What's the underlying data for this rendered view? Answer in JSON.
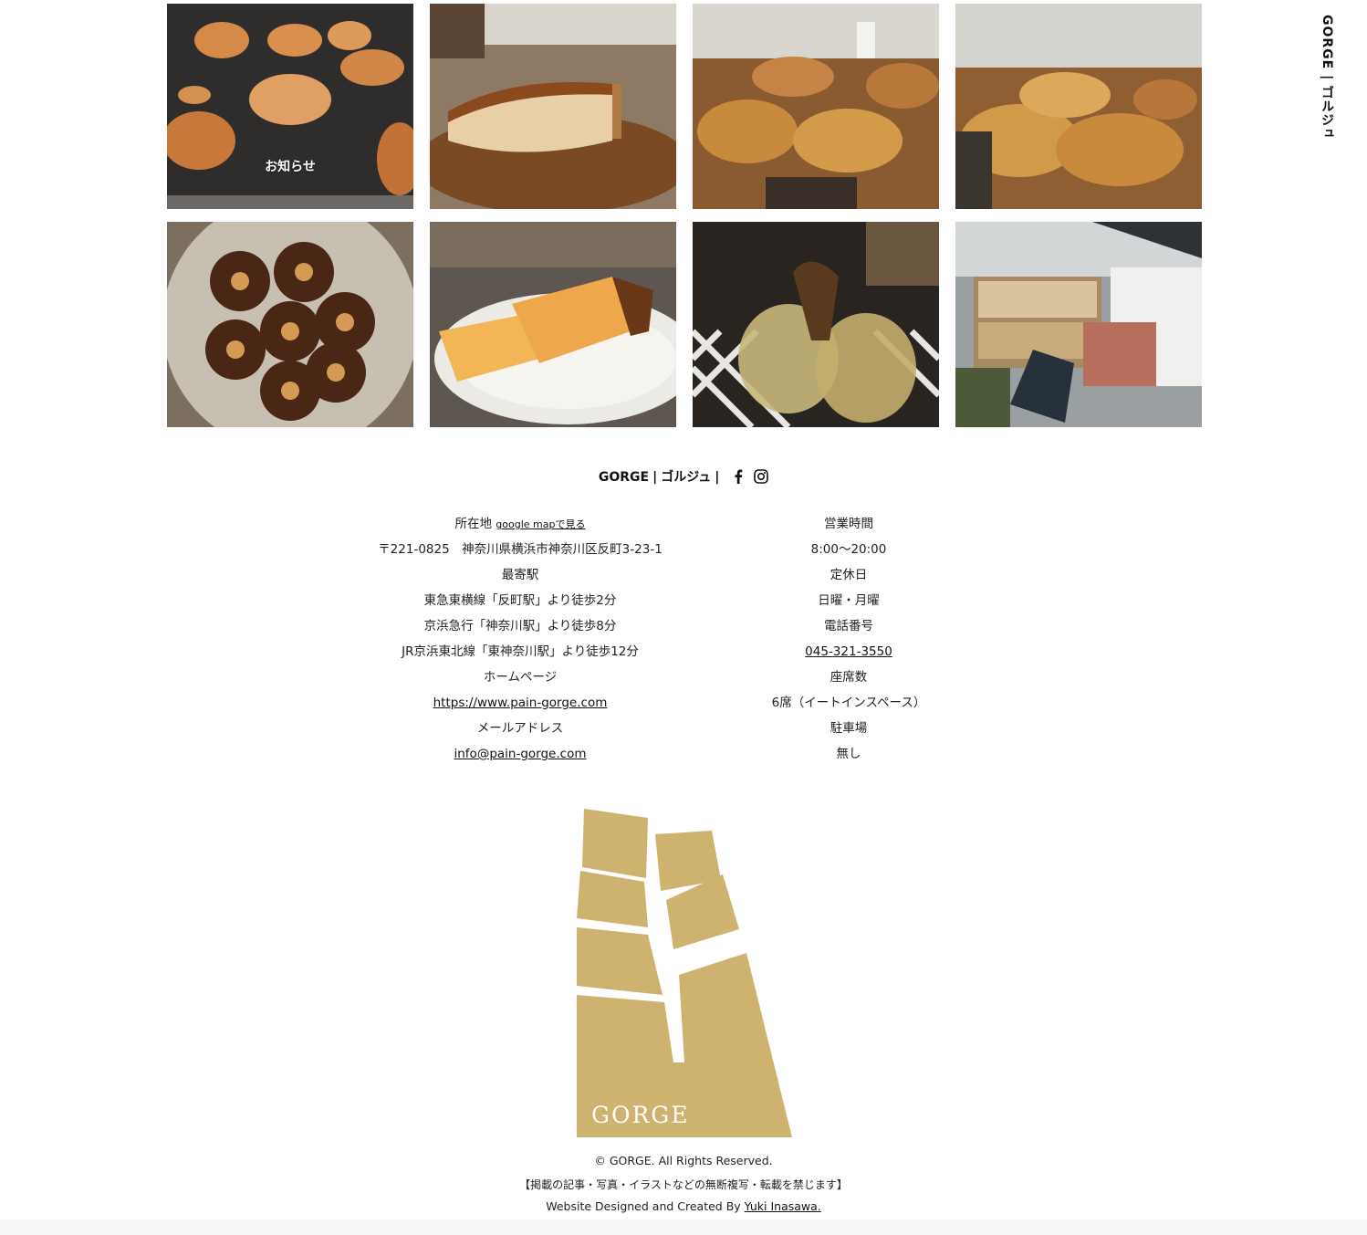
{
  "sidebar": {
    "vertical_title": "GORGE | ゴルジュ"
  },
  "gallery": {
    "tiles": [
      {
        "name": "pastries-tray",
        "label": "お知らせ"
      },
      {
        "name": "cheesecake"
      },
      {
        "name": "bread-display-1"
      },
      {
        "name": "bread-display-2"
      },
      {
        "name": "canele-plate"
      },
      {
        "name": "pound-cake"
      },
      {
        "name": "espresso-glasses"
      },
      {
        "name": "market-stall"
      }
    ]
  },
  "brand": {
    "name": "GORGE",
    "sep": "|",
    "ja": "ゴルジュ",
    "facebook_icon": "facebook-icon",
    "instagram_icon": "instagram-icon"
  },
  "info_left": {
    "location_label": "所在地",
    "map_link": "google mapで見る",
    "address": "〒221-0825　神奈川県横浜市神奈川区反町3-23-1",
    "station_label": "最寄駅",
    "station_1": "東急東横線「反町駅」より徒歩2分",
    "station_2": "京浜急行「神奈川駅」より徒歩8分",
    "station_3": "JR京浜東北線「東神奈川駅」より徒歩12分",
    "homepage_label": "ホームページ",
    "homepage_link": "https://www.pain-gorge.com",
    "email_label": "メールアドレス",
    "email_link": "info@pain-gorge.com"
  },
  "info_right": {
    "hours_label": "営業時間",
    "hours": "8:00〜20:00",
    "closed_label": "定休日",
    "closed": "日曜・月曜",
    "phone_label": "電話番号",
    "phone": "045-321-3550",
    "seats_label": "座席数",
    "seats": "6席（イートインスペース）",
    "parking_label": "駐車場",
    "parking": "無し"
  },
  "logo": {
    "text": "GORGE",
    "color": "#cdb36f"
  },
  "footer": {
    "copyright": "© GORGE. All Rights Reserved.",
    "notice": "【掲載の記事・写真・イラストなどの無断複写・転載を禁じます】",
    "credit_prefix": "Website Designed and Created By ",
    "credit_link": "Yuki Inasawa."
  }
}
